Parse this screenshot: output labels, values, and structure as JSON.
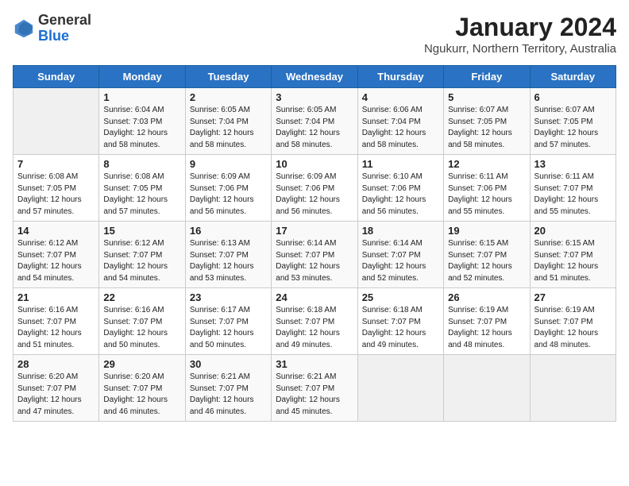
{
  "header": {
    "logo_line1": "General",
    "logo_line2": "Blue",
    "title": "January 2024",
    "subtitle": "Ngukurr, Northern Territory, Australia"
  },
  "weekdays": [
    "Sunday",
    "Monday",
    "Tuesday",
    "Wednesday",
    "Thursday",
    "Friday",
    "Saturday"
  ],
  "weeks": [
    [
      {
        "day": "",
        "info": ""
      },
      {
        "day": "1",
        "info": "Sunrise: 6:04 AM\nSunset: 7:03 PM\nDaylight: 12 hours\nand 58 minutes."
      },
      {
        "day": "2",
        "info": "Sunrise: 6:05 AM\nSunset: 7:04 PM\nDaylight: 12 hours\nand 58 minutes."
      },
      {
        "day": "3",
        "info": "Sunrise: 6:05 AM\nSunset: 7:04 PM\nDaylight: 12 hours\nand 58 minutes."
      },
      {
        "day": "4",
        "info": "Sunrise: 6:06 AM\nSunset: 7:04 PM\nDaylight: 12 hours\nand 58 minutes."
      },
      {
        "day": "5",
        "info": "Sunrise: 6:07 AM\nSunset: 7:05 PM\nDaylight: 12 hours\nand 58 minutes."
      },
      {
        "day": "6",
        "info": "Sunrise: 6:07 AM\nSunset: 7:05 PM\nDaylight: 12 hours\nand 57 minutes."
      }
    ],
    [
      {
        "day": "7",
        "info": "Sunrise: 6:08 AM\nSunset: 7:05 PM\nDaylight: 12 hours\nand 57 minutes."
      },
      {
        "day": "8",
        "info": "Sunrise: 6:08 AM\nSunset: 7:05 PM\nDaylight: 12 hours\nand 57 minutes."
      },
      {
        "day": "9",
        "info": "Sunrise: 6:09 AM\nSunset: 7:06 PM\nDaylight: 12 hours\nand 56 minutes."
      },
      {
        "day": "10",
        "info": "Sunrise: 6:09 AM\nSunset: 7:06 PM\nDaylight: 12 hours\nand 56 minutes."
      },
      {
        "day": "11",
        "info": "Sunrise: 6:10 AM\nSunset: 7:06 PM\nDaylight: 12 hours\nand 56 minutes."
      },
      {
        "day": "12",
        "info": "Sunrise: 6:11 AM\nSunset: 7:06 PM\nDaylight: 12 hours\nand 55 minutes."
      },
      {
        "day": "13",
        "info": "Sunrise: 6:11 AM\nSunset: 7:07 PM\nDaylight: 12 hours\nand 55 minutes."
      }
    ],
    [
      {
        "day": "14",
        "info": "Sunrise: 6:12 AM\nSunset: 7:07 PM\nDaylight: 12 hours\nand 54 minutes."
      },
      {
        "day": "15",
        "info": "Sunrise: 6:12 AM\nSunset: 7:07 PM\nDaylight: 12 hours\nand 54 minutes."
      },
      {
        "day": "16",
        "info": "Sunrise: 6:13 AM\nSunset: 7:07 PM\nDaylight: 12 hours\nand 53 minutes."
      },
      {
        "day": "17",
        "info": "Sunrise: 6:14 AM\nSunset: 7:07 PM\nDaylight: 12 hours\nand 53 minutes."
      },
      {
        "day": "18",
        "info": "Sunrise: 6:14 AM\nSunset: 7:07 PM\nDaylight: 12 hours\nand 52 minutes."
      },
      {
        "day": "19",
        "info": "Sunrise: 6:15 AM\nSunset: 7:07 PM\nDaylight: 12 hours\nand 52 minutes."
      },
      {
        "day": "20",
        "info": "Sunrise: 6:15 AM\nSunset: 7:07 PM\nDaylight: 12 hours\nand 51 minutes."
      }
    ],
    [
      {
        "day": "21",
        "info": "Sunrise: 6:16 AM\nSunset: 7:07 PM\nDaylight: 12 hours\nand 51 minutes."
      },
      {
        "day": "22",
        "info": "Sunrise: 6:16 AM\nSunset: 7:07 PM\nDaylight: 12 hours\nand 50 minutes."
      },
      {
        "day": "23",
        "info": "Sunrise: 6:17 AM\nSunset: 7:07 PM\nDaylight: 12 hours\nand 50 minutes."
      },
      {
        "day": "24",
        "info": "Sunrise: 6:18 AM\nSunset: 7:07 PM\nDaylight: 12 hours\nand 49 minutes."
      },
      {
        "day": "25",
        "info": "Sunrise: 6:18 AM\nSunset: 7:07 PM\nDaylight: 12 hours\nand 49 minutes."
      },
      {
        "day": "26",
        "info": "Sunrise: 6:19 AM\nSunset: 7:07 PM\nDaylight: 12 hours\nand 48 minutes."
      },
      {
        "day": "27",
        "info": "Sunrise: 6:19 AM\nSunset: 7:07 PM\nDaylight: 12 hours\nand 48 minutes."
      }
    ],
    [
      {
        "day": "28",
        "info": "Sunrise: 6:20 AM\nSunset: 7:07 PM\nDaylight: 12 hours\nand 47 minutes."
      },
      {
        "day": "29",
        "info": "Sunrise: 6:20 AM\nSunset: 7:07 PM\nDaylight: 12 hours\nand 46 minutes."
      },
      {
        "day": "30",
        "info": "Sunrise: 6:21 AM\nSunset: 7:07 PM\nDaylight: 12 hours\nand 46 minutes."
      },
      {
        "day": "31",
        "info": "Sunrise: 6:21 AM\nSunset: 7:07 PM\nDaylight: 12 hours\nand 45 minutes."
      },
      {
        "day": "",
        "info": ""
      },
      {
        "day": "",
        "info": ""
      },
      {
        "day": "",
        "info": ""
      }
    ]
  ]
}
